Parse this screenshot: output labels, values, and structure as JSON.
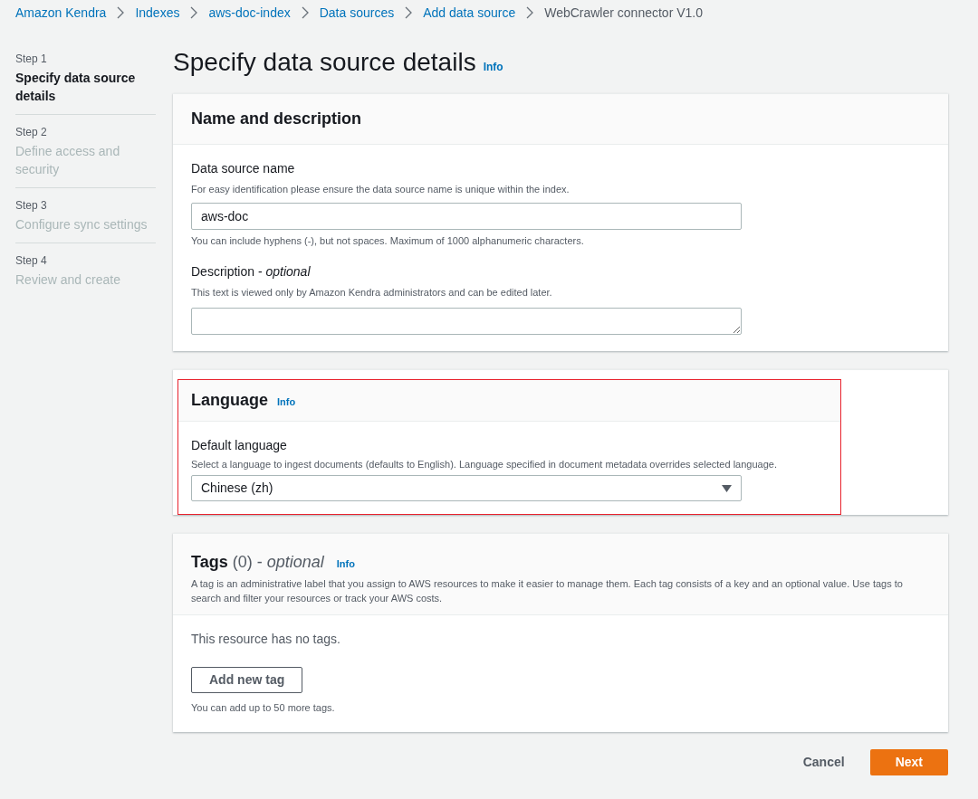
{
  "breadcrumbs": [
    {
      "label": "Amazon Kendra",
      "link": true
    },
    {
      "label": "Indexes",
      "link": true
    },
    {
      "label": "aws-doc-index",
      "link": true
    },
    {
      "label": "Data sources",
      "link": true
    },
    {
      "label": "Add data source",
      "link": true
    },
    {
      "label": "WebCrawler connector V1.0",
      "link": false
    }
  ],
  "steps": [
    {
      "step": "Step 1",
      "label": "Specify data source details",
      "selected": true
    },
    {
      "step": "Step 2",
      "label": "Define access and security",
      "selected": false
    },
    {
      "step": "Step 3",
      "label": "Configure sync settings",
      "selected": false
    },
    {
      "step": "Step 4",
      "label": "Review and create",
      "selected": false
    }
  ],
  "page_title": "Specify data source details",
  "page_info": "Info",
  "name_section": {
    "title": "Name and description",
    "fields": [
      {
        "kind": "input",
        "label": "Data source name",
        "hint": "For easy identification please ensure the data source name is unique within the index.",
        "value": "aws-doc",
        "constraint": "You can include hyphens (-), but not spaces. Maximum of 1000 alphanumeric characters."
      },
      {
        "kind": "textarea",
        "label": "Description - *optional*",
        "hint": "This text is viewed only by Amazon Kendra administrators and can be edited later."
      }
    ]
  },
  "language_section": {
    "title": "Language",
    "info": "Info",
    "highlighted": true,
    "label": "Default language",
    "hint": "Select a language to ingest documents (defaults to English). Language specified in document metadata overrides selected language.",
    "value": "Chinese (zh)"
  },
  "tags_section": {
    "title": "**Tags** (0) - *optional*",
    "info": "Info",
    "description": "A tag is an administrative label that you assign to AWS resources to make it easier to manage them. Each tag consists of a key and an optional value. Use tags to search and filter your resources or track your AWS costs.",
    "empty_text": "This resource has no tags.",
    "add_button": "Add new tag",
    "limit_text": "You can add up to 50 more tags."
  },
  "actions": {
    "cancel": "Cancel",
    "next": "Next"
  }
}
